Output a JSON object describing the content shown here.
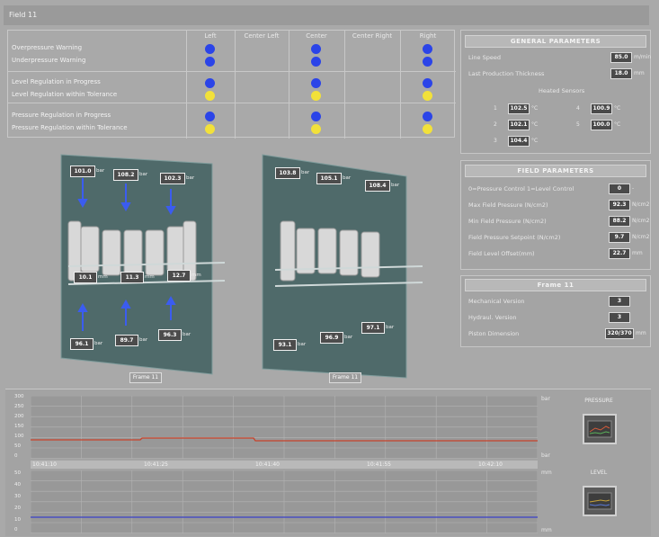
{
  "window": {
    "title": "Field 11"
  },
  "status": {
    "columns": [
      "Left",
      "Center Left",
      "Center",
      "Center Right",
      "Right"
    ],
    "groups": [
      {
        "rows": [
          {
            "label": "Overpressure Warning",
            "dots": [
              "blue",
              "",
              "blue",
              "",
              "blue"
            ]
          },
          {
            "label": "Underpressure Warning",
            "dots": [
              "blue",
              "",
              "blue",
              "",
              "blue"
            ]
          }
        ]
      },
      {
        "rows": [
          {
            "label": "Level Regulation in Progress",
            "dots": [
              "blue",
              "",
              "blue",
              "",
              "blue"
            ]
          },
          {
            "label": "Level Regulation within Tolerance",
            "dots": [
              "yellow",
              "",
              "yellow",
              "",
              "yellow"
            ]
          }
        ]
      },
      {
        "rows": [
          {
            "label": "Pressure Regulation in Progress",
            "dots": [
              "blue",
              "",
              "blue",
              "",
              "blue"
            ]
          },
          {
            "label": "Pressure Regulation within Tolerance",
            "dots": [
              "yellow",
              "",
              "yellow",
              "",
              "yellow"
            ]
          }
        ]
      }
    ]
  },
  "general": {
    "title": "GENERAL PARAMETERS",
    "line_speed": {
      "label": "Line Speed",
      "value": "85.0",
      "unit": "m/min"
    },
    "thickness": {
      "label": "Last Production Thickness",
      "value": "18.0",
      "unit": "mm"
    },
    "sensors_title": "Heated Sensors",
    "sensors": [
      {
        "index": "1",
        "value": "102.5",
        "unit": "°C"
      },
      {
        "index": "4",
        "value": "100.9",
        "unit": "°C"
      },
      {
        "index": "2",
        "value": "102.1",
        "unit": "°C"
      },
      {
        "index": "5",
        "value": "100.0",
        "unit": "°C"
      },
      {
        "index": "3",
        "value": "104.4",
        "unit": "°C"
      }
    ]
  },
  "field": {
    "title": "FIELD PARAMETERS",
    "rows": [
      {
        "label": "0=Pressure Control 1=Level Control",
        "value": "0",
        "unit": "-"
      },
      {
        "label": "Max Field Pressure (N/cm2)",
        "value": "92.3",
        "unit": "N/cm2"
      },
      {
        "label": "Min Field Pressure (N/cm2)",
        "value": "88.2",
        "unit": "N/cm2"
      },
      {
        "label": "Field Pressure Setpoint (N/cm2)",
        "value": "9.7",
        "unit": "N/cm2"
      },
      {
        "label": "Field Level Offset(mm)",
        "value": "22.7",
        "unit": "mm"
      }
    ]
  },
  "frame_info": {
    "title": "Frame 11",
    "rows": [
      {
        "label": "Mechanical Version",
        "value": "3",
        "unit": ""
      },
      {
        "label": "Hydraul. Version",
        "value": "3",
        "unit": ""
      },
      {
        "label": "Piston Dimension",
        "value": "320/370",
        "unit": "mm"
      }
    ]
  },
  "frames": {
    "left": {
      "caption": "Frame 11",
      "top": [
        "101.0",
        "108.2",
        "102.3"
      ],
      "mid": [
        "10.1",
        "11.3",
        "12.7"
      ],
      "bottom": [
        "96.1",
        "89.7",
        "96.3"
      ],
      "unit_bar": "bar",
      "unit_mm": "mm"
    },
    "right": {
      "caption": "Frame 11",
      "top": [
        "103.8",
        "105.1",
        "108.4"
      ],
      "bottom": [
        "93.1",
        "96.9",
        "97.1"
      ],
      "unit_bar": "bar"
    }
  },
  "charts": {
    "pressure": {
      "y_ticks": [
        "300",
        "250",
        "200",
        "150",
        "100",
        "50",
        "0"
      ],
      "unit_top": "bar",
      "unit_bottom": "bar",
      "line_color": "#c8422a"
    },
    "level": {
      "y_ticks": [
        "50",
        "40",
        "30",
        "20",
        "10",
        "0"
      ],
      "unit_top": "mm",
      "unit_bottom": "mm",
      "line_color": "#3a40c8"
    },
    "times": [
      "10:41:10",
      "10:41:25",
      "10:41:40",
      "10:41:55",
      "10:42:10"
    ]
  },
  "side": {
    "pressure_label": "PRESSURE",
    "level_label": "LEVEL"
  }
}
